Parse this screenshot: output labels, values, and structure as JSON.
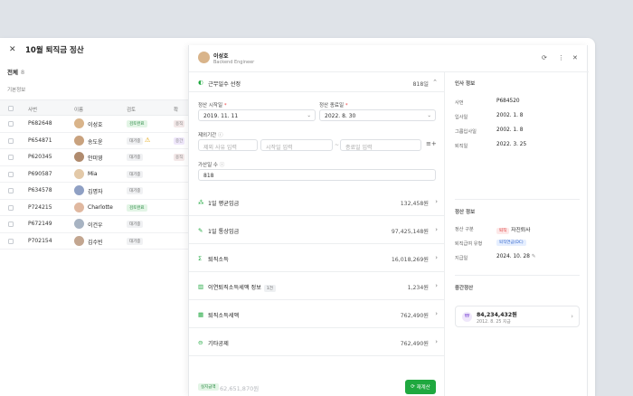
{
  "list": {
    "title": "10월 퇴직금 정산",
    "count_label": "전체",
    "count_value": "8",
    "section": "기본정보",
    "columns": [
      "사번",
      "이름",
      "검토",
      "확"
    ],
    "rows": [
      {
        "id": "P682648",
        "name": "이성호",
        "status": "검토완료",
        "status_type": "done",
        "warn": false,
        "mini": "용직",
        "mini_color": "#f3e8e8"
      },
      {
        "id": "P654871",
        "name": "송도윤",
        "status": "대기중",
        "status_type": "wait",
        "warn": true,
        "mini": "중간",
        "mini_color": "#efe7fb"
      },
      {
        "id": "P620345",
        "name": "안미영",
        "status": "대기중",
        "status_type": "wait",
        "warn": false,
        "mini": "용직",
        "mini_color": "#f3e8e8"
      },
      {
        "id": "P690587",
        "name": "Mia",
        "status": "대기중",
        "status_type": "wait",
        "warn": false,
        "mini": "",
        "mini_color": ""
      },
      {
        "id": "P634578",
        "name": "김명자",
        "status": "대기중",
        "status_type": "wait",
        "warn": false,
        "mini": "",
        "mini_color": ""
      },
      {
        "id": "P724215",
        "name": "Charlotte",
        "status": "검토완료",
        "status_type": "done",
        "warn": false,
        "mini": "",
        "mini_color": ""
      },
      {
        "id": "P672149",
        "name": "이건우",
        "status": "대기중",
        "status_type": "wait",
        "warn": false,
        "mini": "",
        "mini_color": ""
      },
      {
        "id": "P702154",
        "name": "김수빈",
        "status": "대기중",
        "status_type": "wait",
        "warn": false,
        "mini": "",
        "mini_color": ""
      }
    ]
  },
  "panel": {
    "name": "이성호",
    "role": "Backend Engineer",
    "workdays_label": "근무일수 선정",
    "workdays_value": "818일",
    "start_label": "정산 시작일",
    "start_value": "2019. 11. 11",
    "end_label": "정산 종료일",
    "end_value": "2022. 8. 30",
    "exclude_label": "제외기간",
    "reason_placeholder": "제외 사유 입력",
    "from_placeholder": "시작일 입력",
    "to_placeholder": "종료일 입력",
    "add_days_label": "가산일 수",
    "add_days_value": "818",
    "items": [
      {
        "icon": "⁂",
        "color": "#1fa83f",
        "label": "1일 평균임금",
        "tag": "",
        "value": "132,458원"
      },
      {
        "icon": "✎",
        "color": "#1fa83f",
        "label": "1일 통상임금",
        "tag": "",
        "value": "97,425,148원"
      },
      {
        "icon": "Σ",
        "color": "#1fa83f",
        "label": "퇴직소득",
        "tag": "",
        "value": "16,018,269원"
      },
      {
        "icon": "▥",
        "color": "#1fa83f",
        "label": "이연퇴직소득세액 정보",
        "tag": "1건",
        "value": "1,234원"
      },
      {
        "icon": "▦",
        "color": "#1fa83f",
        "label": "퇴직소득세액",
        "tag": "",
        "value": "762,490원"
      },
      {
        "icon": "⊖",
        "color": "#1fa83f",
        "label": "기타공제",
        "tag": "",
        "value": "762,490원"
      }
    ],
    "footer_badge": "실지급액",
    "footer_amount": "62,651,870원",
    "recalc_label": "재계산"
  },
  "side": {
    "hr_title": "인사 정보",
    "hr": [
      {
        "k": "사번",
        "v": "P684520"
      },
      {
        "k": "입사일",
        "v": "2002. 1. 8"
      },
      {
        "k": "그룹입사일",
        "v": "2002. 1. 8"
      },
      {
        "k": "퇴직일",
        "v": "2022. 3. 25"
      }
    ],
    "settle_title": "정산 정보",
    "settle_type_label": "정산 구분",
    "settle_type_pill": "퇴직",
    "settle_type_value": "자진퇴사",
    "pension_label": "퇴직급여 유형",
    "pension_value": "퇴직연금(DC)",
    "pay_label": "지급일",
    "pay_value": "2024. 10. 28",
    "interim_title": "중간정산",
    "interim_amount": "84,234,432원",
    "interim_date": "2012. 8. 25 지급"
  },
  "colors": {
    "accent": "#1fa83f",
    "done_bg": "#e3f5e6",
    "wait_bg": "#f0f1f3"
  }
}
